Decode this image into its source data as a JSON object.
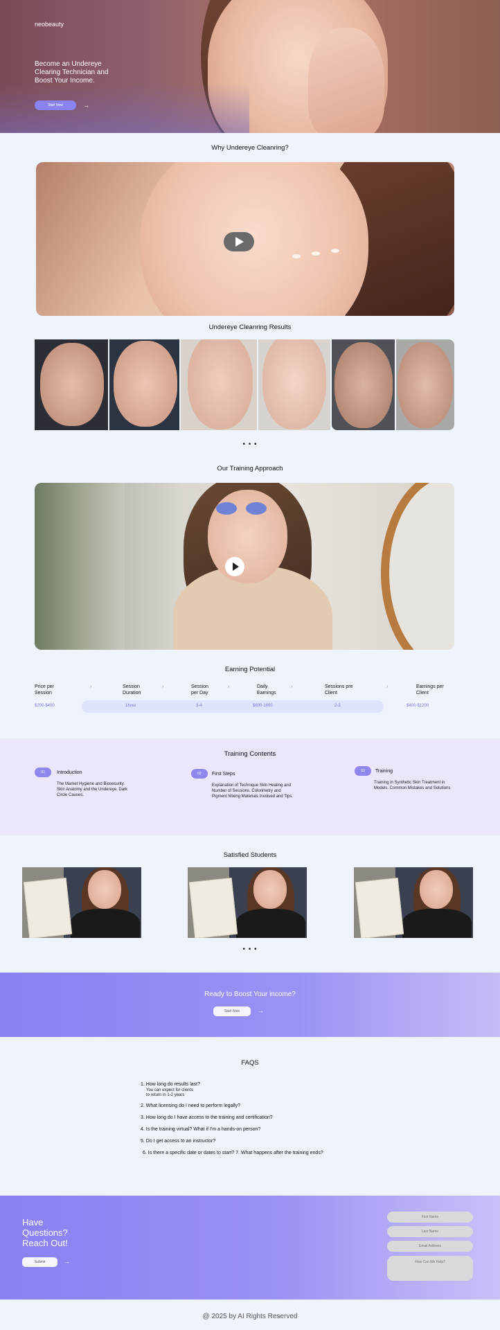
{
  "brand": {
    "logo": "neobeauty"
  },
  "hero": {
    "title": "Become an Undereye Clearing Technician and Boost Your Income.",
    "button_label": "Start Now",
    "arrow": "→"
  },
  "sections": {
    "why_title": "Why Undereye Cleanring?",
    "results_title": "Undereye Cleanring Results",
    "results_dots": "• • •",
    "training_approach_title": "Our Training Approach",
    "earning_title": "Earning Potential",
    "training_contents_title": "Training Contents",
    "students_title": "Satisfied Students",
    "students_dots": "• • •"
  },
  "earning": {
    "columns": [
      {
        "label": "Price per Session",
        "value": "$200-$400"
      },
      {
        "label": "Session Duration",
        "value": "1hour"
      },
      {
        "label": "Session per Day",
        "value": "3-4"
      },
      {
        "label": "Daily Earnings",
        "value": "$600-1600"
      },
      {
        "label": "Sessions pre Client",
        "value": "2-3"
      },
      {
        "label": "Earnings per Client",
        "value": "$400-$1200"
      }
    ],
    "chevron": "›"
  },
  "training": [
    {
      "badge": "01",
      "title": "Introduction",
      "desc": "The Market Hygiene and Biosecurity. Skin Anatomy and the Undereye. Dark Circle Causes."
    },
    {
      "badge": "02",
      "title": "First Steps",
      "desc": "Explanation of Technique Skin Healing and Number of Sessions. Colorimetry and Pigment Mixing Materials Involved and Tips."
    },
    {
      "badge": "03",
      "title": "Training",
      "desc": "Training in Synthetic Skin Treatment in Models. Common Mistakes and Solutions"
    }
  ],
  "cta": {
    "title": "Ready to Boost  Your  income?",
    "button_label": "Start Now",
    "arrow": "→"
  },
  "faq": {
    "title": "FAQS",
    "items": [
      {
        "q": "1. How long do results last?",
        "a": "You can expect for clients to return in 1-2 years"
      },
      {
        "q": "2. What licensing do I need to perform legally?"
      },
      {
        "q": "3. How long do I have access to the training and certification?"
      },
      {
        "q": "4. Is the training virtual? What if I'm a hands-on person?"
      },
      {
        "q": "5. Do I get access to an instructor?"
      },
      {
        "q": "6. Is there a specific date or dates to start? 7. What happens after the training ends?"
      }
    ]
  },
  "contact": {
    "title": "Have Questions? Reach Out!",
    "submit_label": "Submit",
    "arrow": "→",
    "fields": {
      "first_name": "First Name",
      "last_name": "Last Name",
      "email": "Email Address",
      "message": "How Can We Help?"
    }
  },
  "footer": {
    "text": "@ 2025 by AI Rights Reserved"
  },
  "colors": {
    "accent": "#8b84f0",
    "page_bg": "#eef3fc",
    "training_bg": "#ece6fa"
  }
}
